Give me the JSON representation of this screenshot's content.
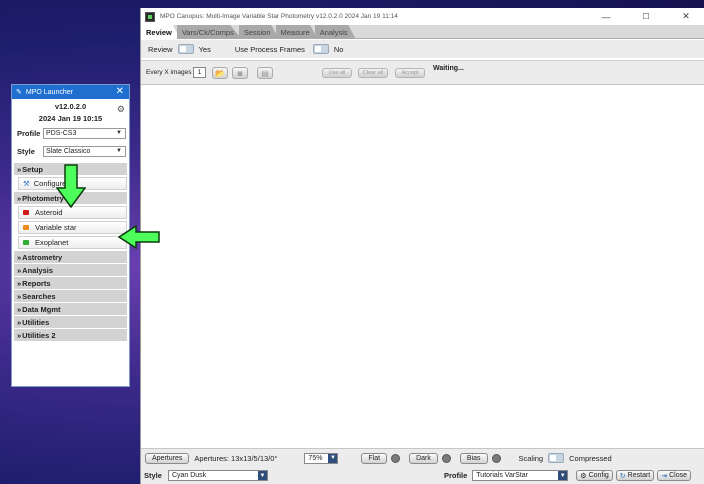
{
  "main_window": {
    "title": "MPO Canopus: Multi-Image Variable Star Photometry  v12.0.2.0  2024 Jan 19  11:14",
    "controls": {
      "minimize": "—",
      "maximize": "☐",
      "close": "✕"
    },
    "tabs": [
      "Review",
      "Vars/Ck/Comps",
      "Session",
      "Measure",
      "Analysis"
    ],
    "active_tab": "Review",
    "review_label": "Review",
    "review_value": "Yes",
    "use_process_frames_label": "Use Process Frames",
    "use_process_frames_value": "No",
    "every_x_images_label": "Every X images",
    "every_x_images_value": "1",
    "toolbar_buttons": [
      "Use all",
      "Clear all",
      "Accept"
    ],
    "status": "Waiting...",
    "apertures_button": "Apertures",
    "apertures_text": "Apertures: 13x13/5/13/0°",
    "zoom": "75%",
    "flat_label": "Flat",
    "dark_label": "Dark",
    "bias_label": "Bias",
    "scaling_label": "Scaling",
    "scaling_value": "Compressed",
    "style_label": "Style",
    "style_value": "Cyan Dusk",
    "profile_label": "Profile",
    "profile_value": "Tutorials VarStar",
    "config_button": "Config",
    "restart_button": "Restart",
    "close_button": "Close"
  },
  "launcher": {
    "title": "MPO Launcher",
    "close": "✕",
    "version": "v12.0.2.0",
    "date": "2024 Jan 19  10:15",
    "profile_label": "Profile",
    "profile_value": "PDS-CS3",
    "style_label": "Style",
    "style_value": "Slate Classico",
    "setup_section": "Setup",
    "configure_item": "Configure",
    "photometry_section": "Photometry",
    "photometry_items": [
      {
        "label": "Asteroid",
        "color": "#d11a1a"
      },
      {
        "label": "Variable star",
        "color": "#f08a1c"
      },
      {
        "label": "Exoplanet",
        "color": "#2fae2f"
      }
    ],
    "collapsed_sections": [
      "Astrometry",
      "Analysis",
      "Reports",
      "Searches",
      "Data Mgmt",
      "Utilities",
      "Utilities 2"
    ]
  },
  "colors": {
    "launcher_title_bg": "#1f6fd0",
    "arrow_green": "#4dff5a",
    "desktop_purple": "#4a2f9a"
  }
}
